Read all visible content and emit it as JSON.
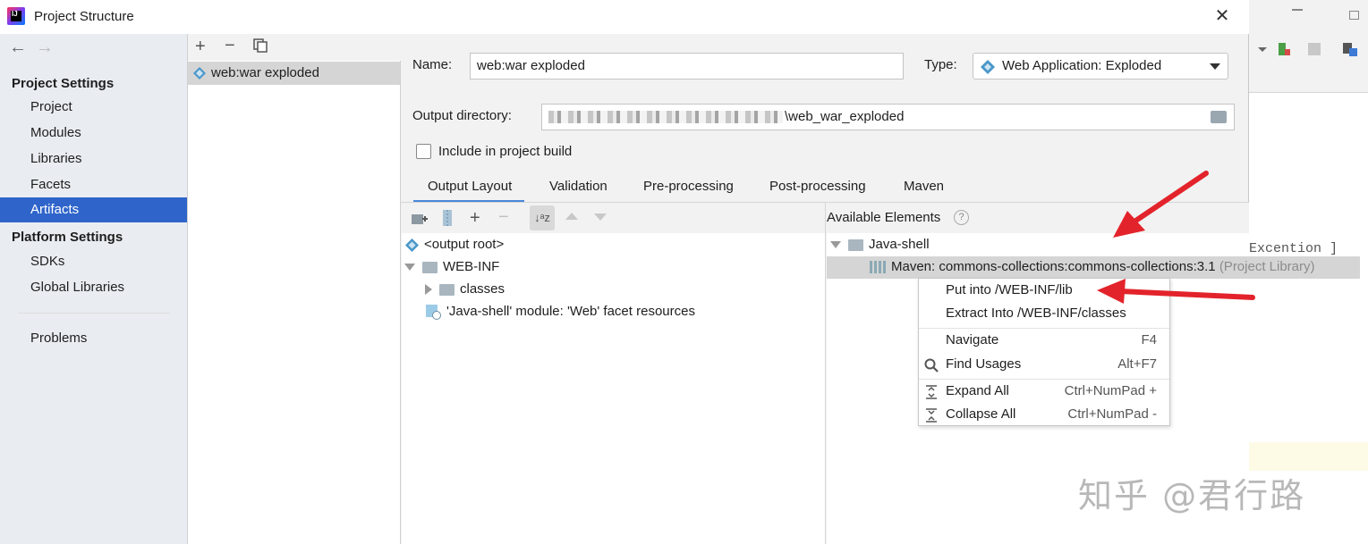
{
  "window": {
    "title": "Project Structure"
  },
  "nav": {
    "back": "←",
    "forward": "→",
    "project_settings_header": "Project Settings",
    "project_settings": [
      "Project",
      "Modules",
      "Libraries",
      "Facets",
      "Artifacts"
    ],
    "selected": "Artifacts",
    "platform_settings_header": "Platform Settings",
    "platform_settings": [
      "SDKs",
      "Global Libraries"
    ],
    "problems": "Problems"
  },
  "artifacts": {
    "items": [
      "web:war exploded"
    ]
  },
  "form": {
    "name_label": "Name:",
    "name_value": "web:war exploded",
    "type_label": "Type:",
    "type_value": "Web Application: Exploded",
    "output_dir_label": "Output directory:",
    "output_dir_value": "\\web_war_exploded",
    "include_label": "Include in project build",
    "include_checked": false
  },
  "tabs": [
    "Output Layout",
    "Validation",
    "Pre-processing",
    "Post-processing",
    "Maven"
  ],
  "active_tab": "Output Layout",
  "layout_tree": [
    {
      "label": "<output root>",
      "icon": "artifact-icon"
    },
    {
      "label": "WEB-INF",
      "icon": "folder-icon",
      "expanded": true
    },
    {
      "label": "classes",
      "icon": "folder-icon",
      "expanded": false
    },
    {
      "label": "'Java-shell' module: 'Web' facet resources",
      "icon": "web-resources-icon"
    }
  ],
  "available": {
    "header": "Available Elements",
    "help": "?",
    "module": "Java-shell",
    "library": "Maven: commons-collections:commons-collections:3.1",
    "library_suffix": "(Project Library)"
  },
  "context_menu": {
    "items": [
      {
        "label": "Put into /WEB-INF/lib",
        "shortcut": ""
      },
      {
        "label": "Extract Into /WEB-INF/classes",
        "shortcut": ""
      },
      {
        "label": "Navigate",
        "shortcut": "F4"
      },
      {
        "label": "Find Usages",
        "shortcut": "Alt+F7"
      },
      {
        "label": "Expand All",
        "shortcut": "Ctrl+NumPad +"
      },
      {
        "label": "Collapse All",
        "shortcut": "Ctrl+NumPad -"
      }
    ]
  },
  "background": {
    "code_fragment": "Excention  ]"
  },
  "watermark": "知乎 @君行路",
  "colors": {
    "selection": "#2f65ca",
    "annotation_arrow": "#e3232b"
  }
}
